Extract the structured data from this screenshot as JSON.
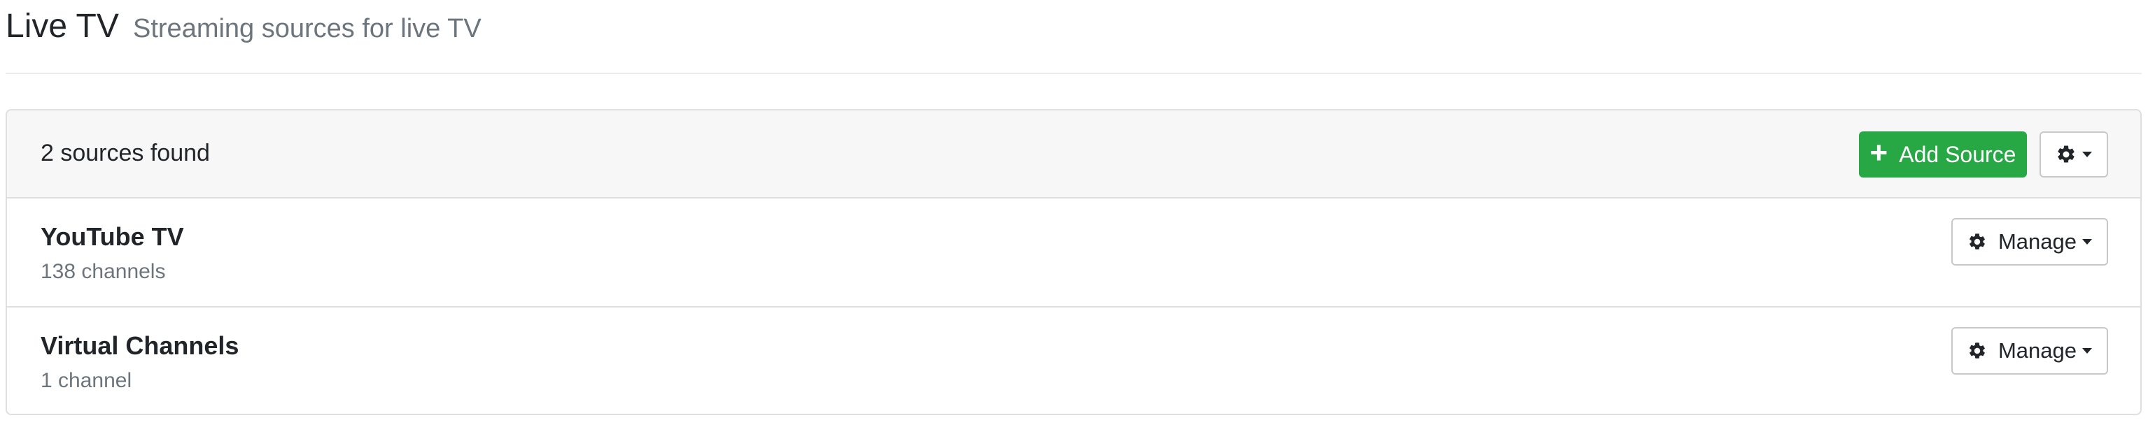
{
  "header": {
    "title": "Live TV",
    "subtitle": "Streaming sources for live TV"
  },
  "sources_panel": {
    "count_text": "2 sources found",
    "add_button_label": "Add Source",
    "add_icon": "plus-icon",
    "settings_icon": "gear-icon",
    "accent_color": "#28a745",
    "sources": [
      {
        "name": "YouTube TV",
        "channels": "138 channels",
        "manage_label": "Manage",
        "manage_icon": "gear-icon"
      },
      {
        "name": "Virtual Channels",
        "channels": "1 channel",
        "manage_label": "Manage",
        "manage_icon": "gear-icon"
      }
    ]
  }
}
